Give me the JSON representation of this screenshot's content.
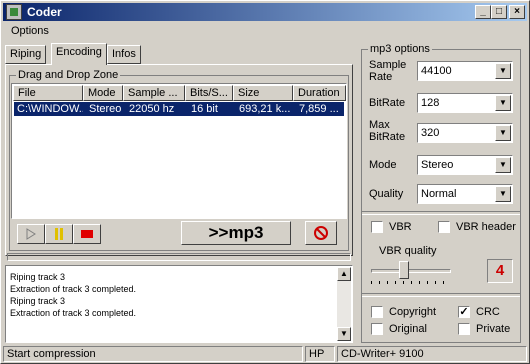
{
  "window": {
    "title": "Coder"
  },
  "menu": {
    "options": "Options"
  },
  "tabs": [
    "Riping",
    "Encoding",
    "Infos"
  ],
  "dropzone": {
    "legend": "Drag and Drop Zone",
    "columns": [
      "File",
      "Mode",
      "Sample ...",
      "Bits/S...",
      "Size",
      "Duration"
    ],
    "rows": [
      [
        "C:\\WINDOW...",
        "Stereo",
        "22050 hz",
        "16 bit",
        "693,21 k...",
        "7,859 ..."
      ]
    ]
  },
  "player": {
    "convert_label": ">>mp3"
  },
  "log": {
    "lines": [
      "Riping track 3",
      "Extraction of track 3 completed.",
      "Riping track 3",
      "Extraction of track 3 completed."
    ]
  },
  "mp3": {
    "legend": "mp3 options",
    "sample_rate_label": "Sample Rate",
    "sample_rate_value": "44100",
    "bitrate_label": "BitRate",
    "bitrate_value": "128",
    "max_bitrate_label": "Max BitRate",
    "max_bitrate_value": "320",
    "mode_label": "Mode",
    "mode_value": "Stereo",
    "quality_label": "Quality",
    "quality_value": "Normal",
    "vbr_label": "VBR",
    "vbr_header_label": "VBR header",
    "vbr_quality_label": "VBR quality",
    "vbr_quality_value": "4",
    "vbr_quality_fraction": 0.4,
    "copyright_label": "Copyright",
    "crc_label": "CRC",
    "original_label": "Original",
    "private_label": "Private",
    "crc_checked": true
  },
  "status": {
    "text": "Start compression",
    "drive_vendor": "HP",
    "drive_model": "CD-Writer+ 9100"
  },
  "colors": {
    "title_start": "#0a246a",
    "title_end": "#a6caf0",
    "selection": "#0a246a",
    "vbr_value": "#cc0000"
  }
}
